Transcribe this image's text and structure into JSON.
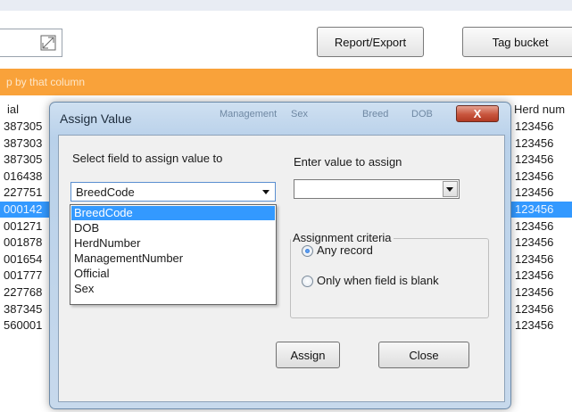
{
  "toolbar": {
    "report_export_label": "Report/Export",
    "tag_bucket_label": "Tag bucket"
  },
  "group_hint": "p by that column",
  "grid": {
    "columns": [
      "ial",
      "Herd num"
    ],
    "rows": [
      {
        "left": "387305",
        "right": "123456",
        "selected": false
      },
      {
        "left": "387303",
        "right": "123456",
        "selected": false
      },
      {
        "left": "387305",
        "right": "123456",
        "selected": false
      },
      {
        "left": "016438",
        "right": "123456",
        "selected": false
      },
      {
        "left": "227751",
        "right": "123456",
        "selected": false
      },
      {
        "left": "000142",
        "right": "123456",
        "selected": true
      },
      {
        "left": "001271",
        "right": "123456",
        "selected": false
      },
      {
        "left": "001878",
        "right": "123456",
        "selected": false
      },
      {
        "left": "001654",
        "right": "123456",
        "selected": false
      },
      {
        "left": "001777",
        "right": "123456",
        "selected": false
      },
      {
        "left": "227768",
        "right": "123456",
        "selected": false
      },
      {
        "left": "387345",
        "right": "123456",
        "selected": false
      },
      {
        "left": "560001",
        "right": "123456",
        "selected": false
      }
    ]
  },
  "dialog": {
    "title": "Assign Value",
    "ghost_titles": [
      "Management",
      "Sex",
      "Breed",
      "DOB"
    ],
    "close_glyph": "X",
    "field_label": "Select field to assign value to",
    "field_selected": "BreedCode",
    "field_options": [
      "BreedCode",
      "DOB",
      "HerdNumber",
      "ManagementNumber",
      "Official",
      "Sex"
    ],
    "value_label": "Enter value to assign",
    "value_current": "",
    "criteria_label": "Assignment criteria",
    "radio_any": "Any record",
    "radio_blank": "Only when field is blank",
    "assign_label": "Assign",
    "close_label": "Close"
  },
  "colors": {
    "selection": "#3399ff",
    "group_bar": "#f9a23a",
    "close_button": "#c8553d"
  }
}
